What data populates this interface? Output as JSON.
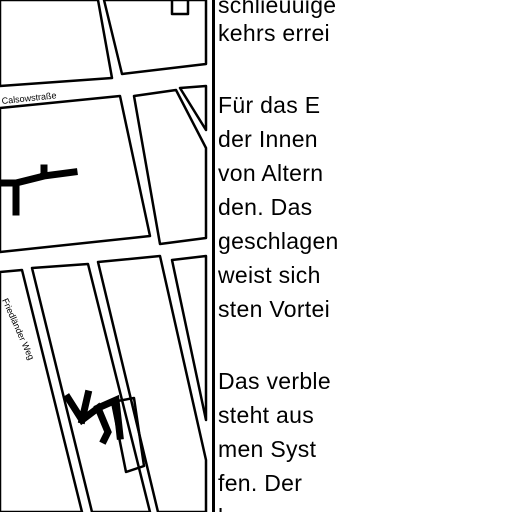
{
  "map": {
    "streets": [
      "Calsowstraße",
      "Friedländer Weg"
    ]
  },
  "text": {
    "lines": [
      "schlieuuige",
      "kehrs errei",
      "Für das E",
      "der Innen",
      "von Altern",
      "den. Das",
      "geschlagen",
      "weist sich",
      "sten Vortei",
      "Das verble",
      "steht aus",
      "men Syst",
      "fen. Der",
      "l"
    ]
  }
}
